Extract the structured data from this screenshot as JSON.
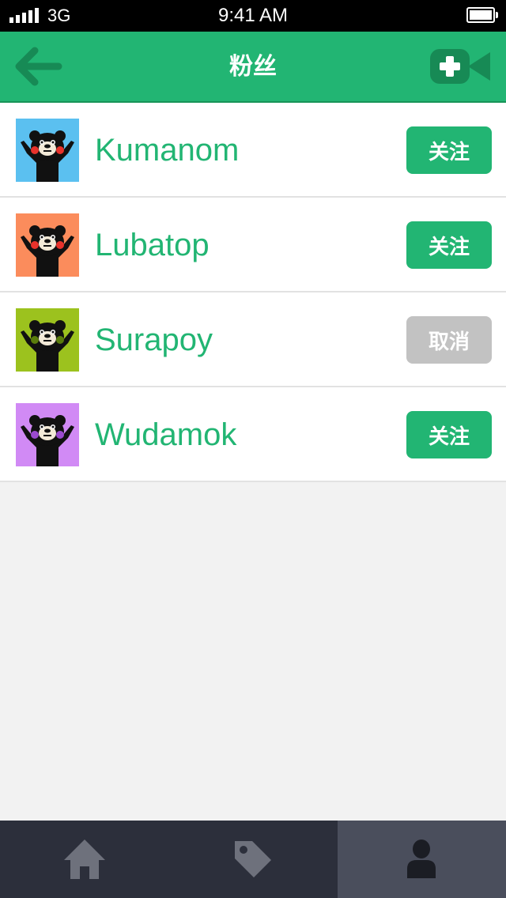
{
  "status_bar": {
    "carrier": "3G",
    "time": "9:41 AM"
  },
  "header": {
    "title": "粉丝",
    "back_icon": "arrow-left-icon",
    "action_icon": "add-video-icon"
  },
  "colors": {
    "brand": "#22b573",
    "follow_button": "#22b573",
    "cancel_button": "#c2c2c2",
    "tab_bar": "#2c2f3b",
    "tab_active": "#4a4e5c"
  },
  "fans": [
    {
      "name": "Kumanom",
      "button_label": "关注",
      "state": "follow",
      "avatar_bg": "#5bc0f0",
      "cheek_color": "#e8322b"
    },
    {
      "name": "Lubatop",
      "button_label": "关注",
      "state": "follow",
      "avatar_bg": "#fb8c5c",
      "cheek_color": "#e8322b"
    },
    {
      "name": "Surapoy",
      "button_label": "取消",
      "state": "cancel",
      "avatar_bg": "#9cc21e",
      "cheek_color": "#5a7d0c"
    },
    {
      "name": "Wudamok",
      "button_label": "关注",
      "state": "follow",
      "avatar_bg": "#d18af5",
      "cheek_color": "#9b4ad0"
    }
  ],
  "tab_bar": {
    "tabs": [
      {
        "icon": "home-icon",
        "active": false
      },
      {
        "icon": "tag-icon",
        "active": false
      },
      {
        "icon": "user-icon",
        "active": true
      }
    ]
  }
}
